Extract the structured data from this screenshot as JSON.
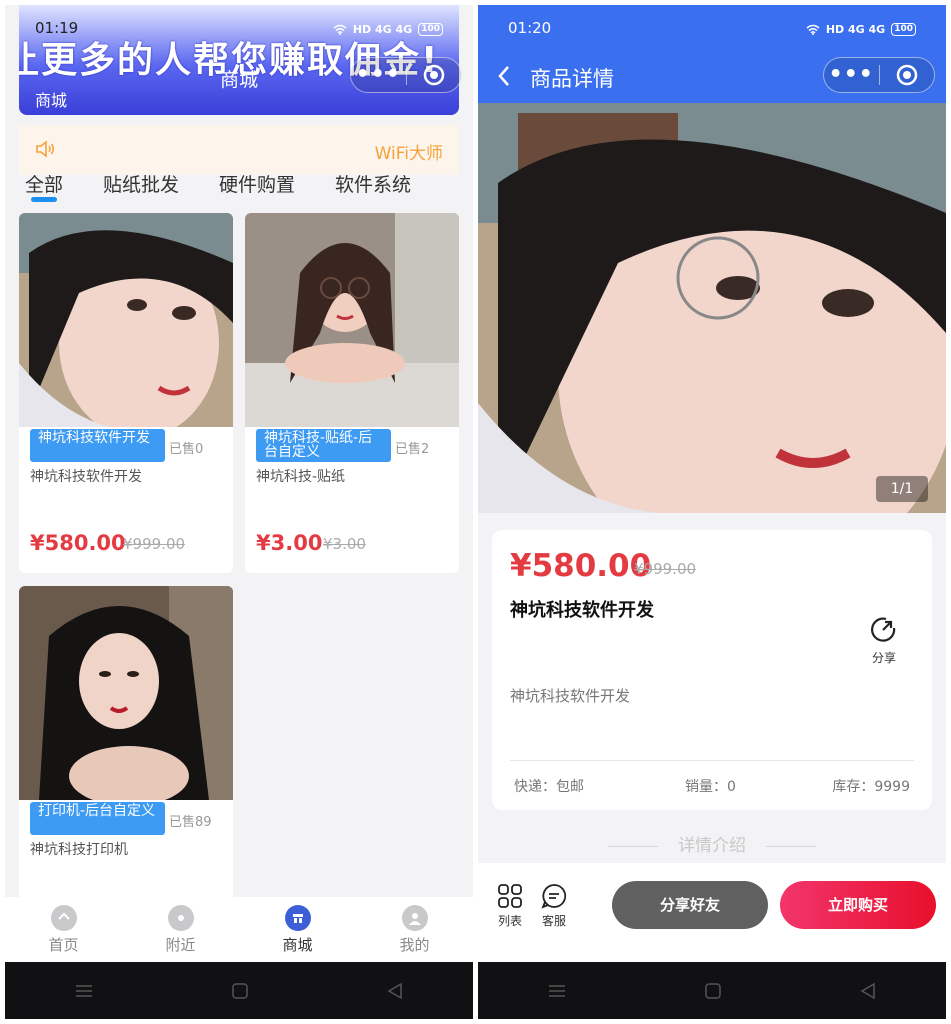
{
  "left": {
    "status": {
      "time": "01:19",
      "icons": "HD 4G 4G",
      "battery": "100"
    },
    "banner": {
      "text": "让更多的人帮您赚取佣金!",
      "label": "商城"
    },
    "nav": {
      "title": "商城",
      "capsule_menu": "more-dots-icon",
      "capsule_close": "target-icon"
    },
    "notice": {
      "icon": "speaker-icon",
      "text": "WiFi大师"
    },
    "tabs": [
      "全部",
      "贴纸批发",
      "硬件购置",
      "软件系统"
    ],
    "products": [
      {
        "badge": "神坑科技软件开发",
        "sold": "已售0",
        "desc": "神坑科技软件开发",
        "price": "¥580.00",
        "original_price": "¥999.00"
      },
      {
        "badge": "神坑科技-贴纸-后台自定义",
        "sold": "已售2",
        "desc": "神坑科技-贴纸",
        "price": "¥3.00",
        "original_price": "¥3.00"
      },
      {
        "badge": "打印机-后台自定义",
        "sold": "已售89",
        "desc": "神坑科技打印机",
        "price": "",
        "original_price": ""
      }
    ],
    "tabbar": [
      {
        "label": "首页",
        "icon": "home-icon"
      },
      {
        "label": "附近",
        "icon": "location-icon"
      },
      {
        "label": "商城",
        "icon": "store-icon"
      },
      {
        "label": "我的",
        "icon": "user-icon"
      }
    ],
    "system_nav": [
      "menu-icon",
      "home-square-icon",
      "back-triangle-icon"
    ]
  },
  "right": {
    "status": {
      "time": "01:20",
      "icons": "HD 4G 4G",
      "battery": "100"
    },
    "nav": {
      "title": "商品详情",
      "back_icon": "chevron-left-icon"
    },
    "gallery": {
      "counter": "1/1"
    },
    "product": {
      "price": "¥580.00",
      "original_price": "¥999.00",
      "name": "神坑科技软件开发",
      "share_label": "分享",
      "description": "神坑科技软件开发",
      "shipping": "快递：包邮",
      "sales": "销量：0",
      "stock": "库存：9999"
    },
    "section_title": "详情介绍",
    "bottom_bar": {
      "list_label": "列表",
      "service_label": "客服",
      "share_button": "分享好友",
      "buy_button": "立即购买"
    }
  },
  "colors": {
    "accent_blue": "#3a70f0",
    "price_red": "#e33b41",
    "badge_blue": "#3d9bf3",
    "notice_orange": "#f6a23b",
    "buy_red": "#e8102c"
  }
}
